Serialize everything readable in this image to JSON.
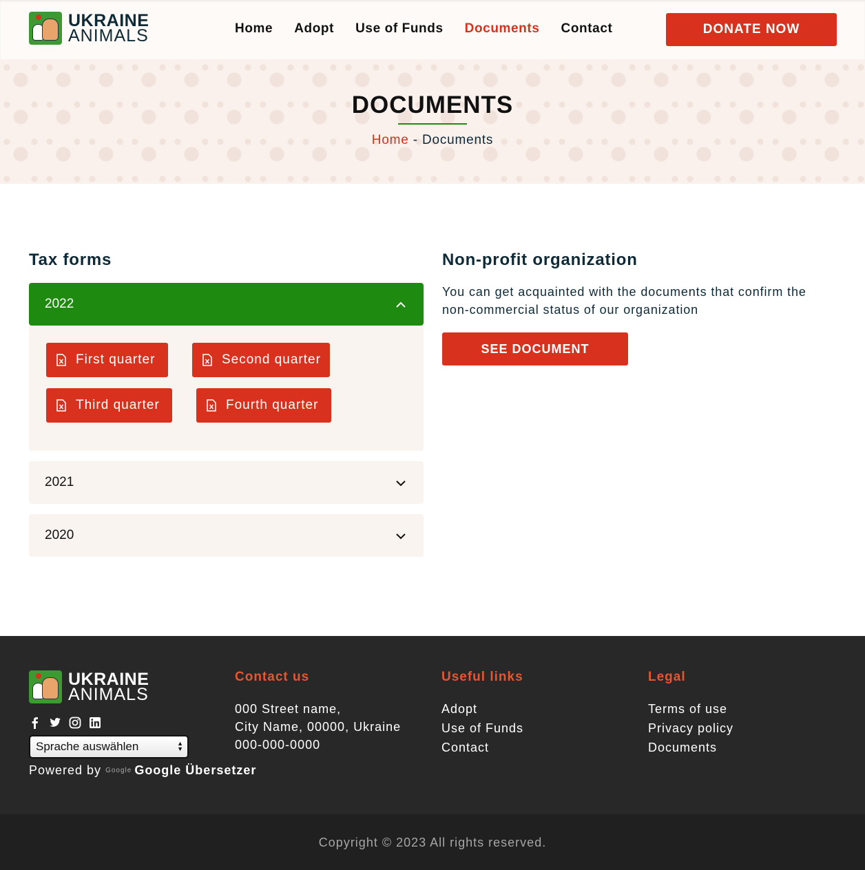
{
  "brand": {
    "line1": "UKRAINE",
    "line2": "ANIMALS"
  },
  "nav": {
    "items": [
      {
        "label": "Home"
      },
      {
        "label": "Adopt"
      },
      {
        "label": "Use of Funds"
      },
      {
        "label": "Documents",
        "active": true
      },
      {
        "label": "Contact"
      }
    ],
    "donate_label": "DONATE NOW"
  },
  "hero": {
    "title": "DOCUMENTS",
    "breadcrumb": {
      "home": "Home",
      "separator": " - ",
      "current": "Documents"
    }
  },
  "tax_forms": {
    "title": "Tax forms",
    "years": [
      {
        "label": "2022",
        "expanded": true
      },
      {
        "label": "2021",
        "expanded": false
      },
      {
        "label": "2020",
        "expanded": false
      }
    ],
    "documents": [
      {
        "label": "First quarter"
      },
      {
        "label": "Second quarter"
      },
      {
        "label": "Third quarter"
      },
      {
        "label": "Fourth quarter"
      }
    ]
  },
  "nonprofit": {
    "title": "Non-profit organization",
    "text": "You can get acquainted with the documents that confirm the non-commercial status of our organization",
    "button_label": "SEE DOCUMENT"
  },
  "footer": {
    "language_select": "Sprache auswählen",
    "powered_by": "Powered by",
    "google_mark": "Google",
    "translator": "Google Übersetzer",
    "contact": {
      "title": "Contact us",
      "address1": "000 Street name,",
      "address2": "City Name, 00000, Ukraine",
      "phone": "000-000-0000"
    },
    "useful": {
      "title": "Useful links",
      "links": [
        "Adopt",
        "Use of Funds",
        "Contact"
      ]
    },
    "legal": {
      "title": "Legal",
      "links": [
        "Terms of use",
        "Privacy policy",
        "Documents"
      ]
    },
    "copyright": "Copyright © 2023 All rights reserved."
  },
  "colors": {
    "accent": "#d8321e",
    "green": "#1f8a10",
    "dark_text": "#0e2a36",
    "footer_bg": "#282828",
    "footer_heading": "#e8562f"
  }
}
